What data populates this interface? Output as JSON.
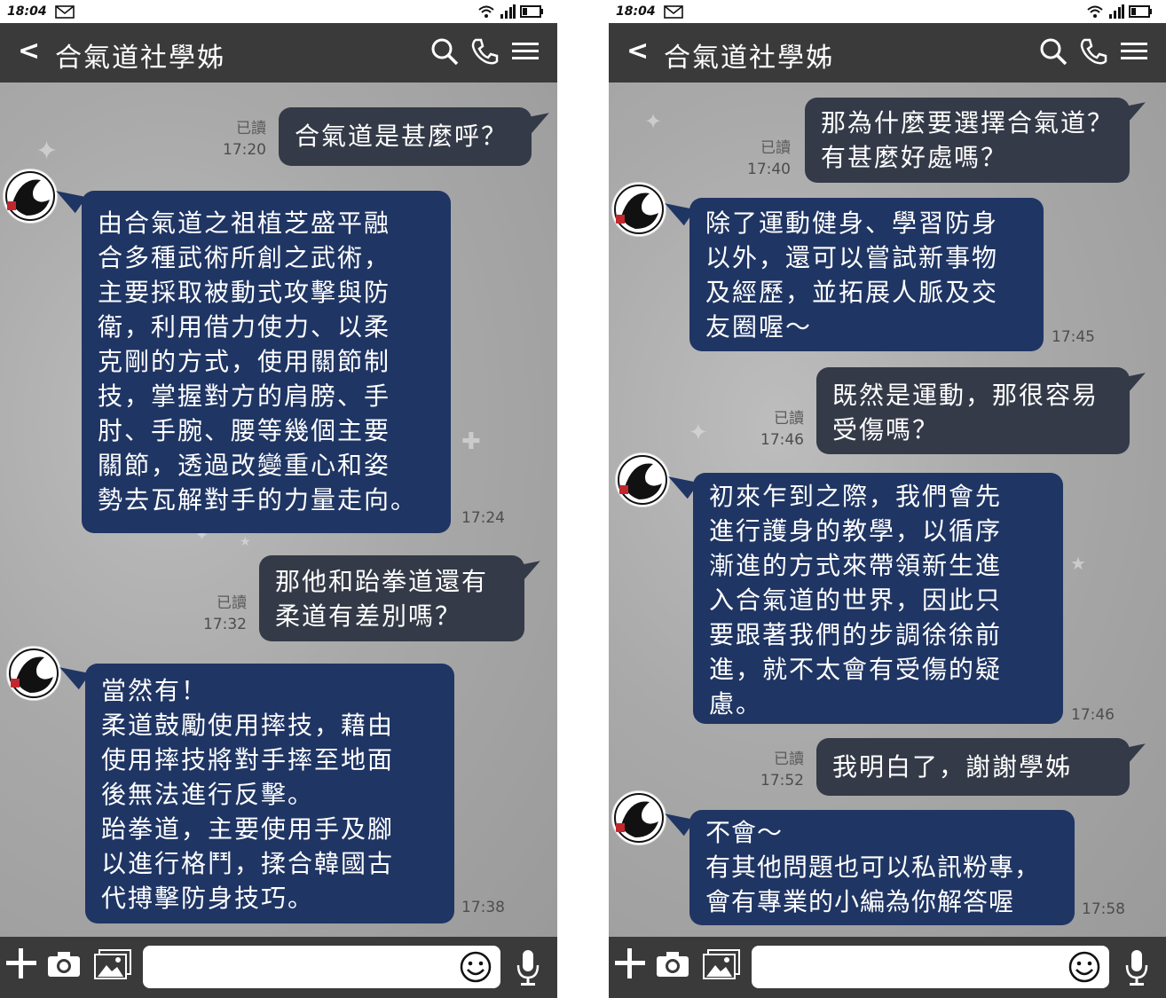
{
  "status_time": "18:04",
  "chat_title": "合氣道社學姊",
  "back_label": "<",
  "read_label": "已讀",
  "icons": [
    "mail-icon",
    "wifi-icon",
    "signal-icon",
    "battery-icon",
    "back-icon",
    "search-icon",
    "phone-icon",
    "menu-icon",
    "avatar-icon",
    "plus-icon",
    "camera-icon",
    "gallery-icon",
    "smiley-icon",
    "microphone-icon"
  ],
  "colors": {
    "header": "#3a3a3a",
    "sent_bubble": "#343a47",
    "received_bubble": "#1f3564",
    "chat_bg": "#a9a9a9"
  },
  "screens": [
    {
      "messages": [
        {
          "from": "me",
          "text": "合氣道是甚麼呼？",
          "time": "17:20",
          "read": true
        },
        {
          "from": "senior",
          "text": "由合氣道之祖植芝盛平融\n合多種武術所創之武術，\n主要採取被動式攻擊與防\n衛，利用借力使力、以柔\n克剛的方式，使用關節制\n技，掌握對方的肩膀、手\n肘、手腕、腰等幾個主要\n關節，透過改變重心和姿\n勢去瓦解對手的力量走向。",
          "time": "17:24"
        },
        {
          "from": "me",
          "text": "那他和跆拳道還有\n柔道有差別嗎？",
          "time": "17:32",
          "read": true
        },
        {
          "from": "senior",
          "text": "當然有！\n柔道鼓勵使用摔技，藉由\n使用摔技將對手摔至地面\n後無法進行反擊。\n跆拳道，主要使用手及腳\n以進行格鬥，揉合韓國古\n代搏擊防身技巧。",
          "time": "17:38"
        }
      ]
    },
    {
      "messages": [
        {
          "from": "me",
          "text": "那為什麼要選擇合氣道？\n有甚麼好處嗎？",
          "time": "17:40",
          "read": true
        },
        {
          "from": "senior",
          "text": "除了運動健身、學習防身\n以外，還可以嘗試新事物\n及經歷，並拓展人脈及交\n友圈喔～",
          "time": "17:45"
        },
        {
          "from": "me",
          "text": "既然是運動，那很容易\n受傷嗎？",
          "time": "17:46",
          "read": true
        },
        {
          "from": "senior",
          "text": "初來乍到之際，我們會先\n進行護身的教學，以循序\n漸進的方式來帶領新生進\n入合氣道的世界，因此只\n要跟著我們的步調徐徐前\n進，就不太會有受傷的疑\n慮。",
          "time": "17:46"
        },
        {
          "from": "me",
          "text": "我明白了，謝謝學姊",
          "time": "17:52",
          "read": true
        },
        {
          "from": "senior",
          "text": "不會～\n有其他問題也可以私訊粉專，\n會有專業的小編為你解答喔",
          "time": "17:58"
        }
      ]
    }
  ]
}
